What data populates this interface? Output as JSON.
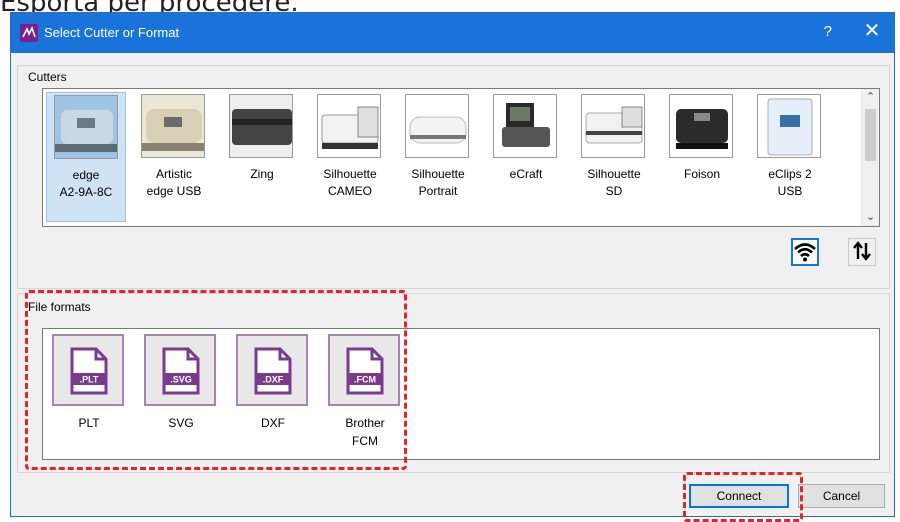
{
  "caption": "Esporta per procedere.",
  "dialog": {
    "title": "Select Cutter or Format",
    "help_label": "?",
    "close_label": "✕"
  },
  "cutters": {
    "group_label": "Cutters",
    "items": [
      {
        "label": "edge\nA2-9A-8C",
        "selected": true
      },
      {
        "label": "Artistic\nedge USB"
      },
      {
        "label": "Zing"
      },
      {
        "label": "Silhouette\nCAMEO"
      },
      {
        "label": "Silhouette\nPortrait"
      },
      {
        "label": "eCraft"
      },
      {
        "label": "Silhouette\nSD"
      },
      {
        "label": "Foison"
      },
      {
        "label": "eClips 2\nUSB"
      }
    ]
  },
  "file_formats": {
    "group_label": "File formats",
    "items": [
      {
        "label": "PLT",
        "icon_text": ".PLT"
      },
      {
        "label": "SVG",
        "icon_text": ".SVG"
      },
      {
        "label": "DXF",
        "icon_text": ".DXF"
      },
      {
        "label": "Brother\nFCM",
        "icon_text": ".FCM"
      }
    ]
  },
  "buttons": {
    "connect": "Connect",
    "cancel": "Cancel"
  },
  "colors": {
    "titlebar": "#1a73d9",
    "selection": "#cfe3f7",
    "highlight_dash": "#e8222a",
    "format_icon": "#7a3b8f"
  }
}
